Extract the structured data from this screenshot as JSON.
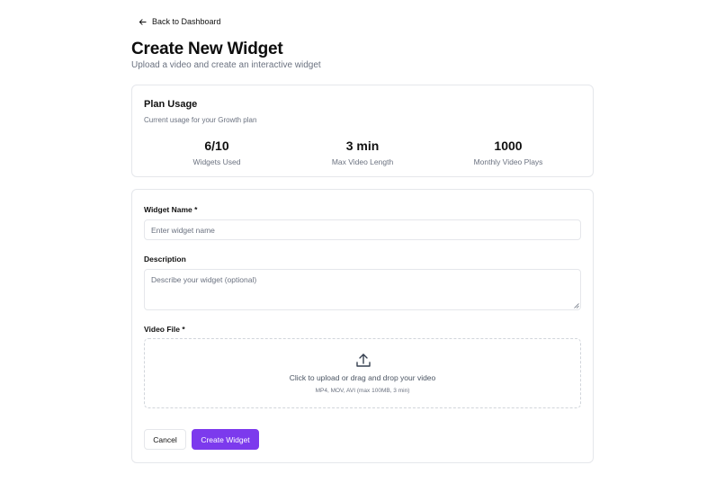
{
  "nav": {
    "back_label": "Back to Dashboard"
  },
  "header": {
    "title": "Create New Widget",
    "subtitle": "Upload a video and create an interactive widget"
  },
  "usage": {
    "title": "Plan Usage",
    "description": "Current usage for your Growth plan",
    "stats": [
      {
        "value": "6/10",
        "label": "Widgets Used"
      },
      {
        "value": "3 min",
        "label": "Max Video Length"
      },
      {
        "value": "1000",
        "label": "Monthly Video Plays"
      }
    ]
  },
  "form": {
    "name_label": "Widget Name *",
    "name_placeholder": "Enter widget name",
    "name_value": "",
    "description_label": "Description",
    "description_placeholder": "Describe your widget (optional)",
    "description_value": "",
    "video_label": "Video File *",
    "dropzone_text": "Click to upload or drag and drop your video",
    "dropzone_hint": "MP4, MOV, AVI (max 100MB, 3 min)",
    "upload_icon": "upload-icon"
  },
  "actions": {
    "cancel_label": "Cancel",
    "create_label": "Create Widget"
  },
  "colors": {
    "accent": "#7c3aed",
    "muted_text": "#6b7280",
    "border": "#e5e7eb"
  }
}
